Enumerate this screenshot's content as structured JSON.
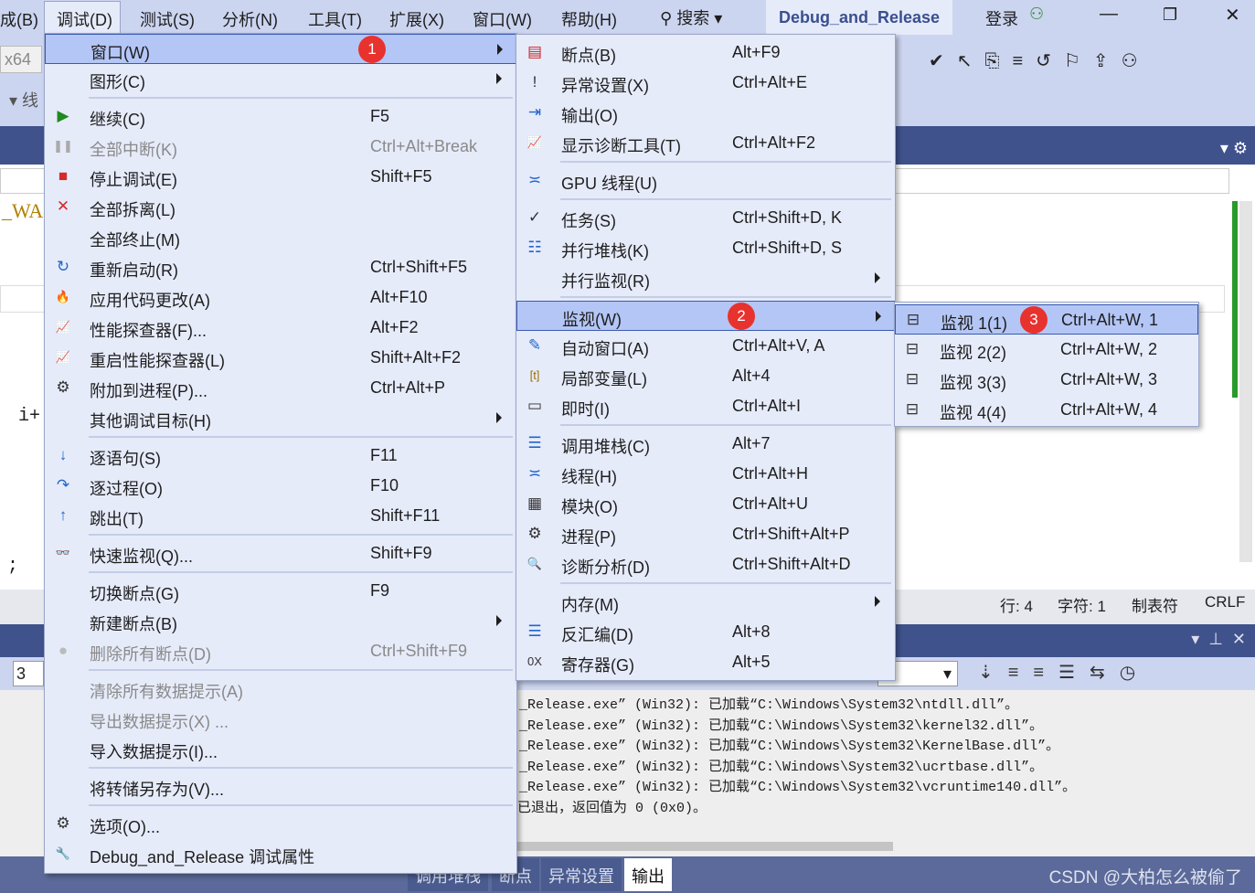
{
  "menubar": {
    "items": [
      "成(B)",
      "调试(D)",
      "测试(S)",
      "分析(N)",
      "工具(T)",
      "扩展(X)",
      "窗口(W)",
      "帮助(H)"
    ],
    "search": "搜索",
    "solution_title": "Debug_and_Release",
    "login": "登录"
  },
  "toolbar": {
    "platform": "x64",
    "thread_label": "线"
  },
  "editor": {
    "snippets": [
      "_WAR",
      "i+",
      ";"
    ]
  },
  "status": {
    "line": "行: 4",
    "char": "字符: 1",
    "tabs": "制表符",
    "eol": "CRLF"
  },
  "output": {
    "stack_field": "3",
    "lines": [
      "_Release.exe” (Win32): 已加载“C:\\Windows\\System32\\ntdll.dll”。",
      "_Release.exe” (Win32): 已加载“C:\\Windows\\System32\\kernel32.dll”。",
      "_Release.exe” (Win32): 已加载“C:\\Windows\\System32\\KernelBase.dll”。",
      "_Release.exe” (Win32): 已加载“C:\\Windows\\System32\\ucrtbase.dll”。",
      "_Release.exe” (Win32): 已加载“C:\\Windows\\System32\\vcruntime140.dll”。",
      "已退出，返回值为 0 (0x0)。"
    ]
  },
  "bottom_tabs": [
    "调用堆栈",
    "断点",
    "异常设置",
    "输出"
  ],
  "watermark": "CSDN @大柏怎么被偷了",
  "debug_menu": [
    {
      "label": "窗口(W)",
      "submenu": true,
      "highlight": true,
      "badge": "1"
    },
    {
      "label": "图形(C)",
      "submenu": true
    },
    {
      "sep": true
    },
    {
      "label": "继续(C)",
      "shortcut": "F5",
      "icon": "play-icon"
    },
    {
      "label": "全部中断(K)",
      "shortcut": "Ctrl+Alt+Break",
      "icon": "pause-icon",
      "disabled": true
    },
    {
      "label": "停止调试(E)",
      "shortcut": "Shift+F5",
      "icon": "stop-icon"
    },
    {
      "label": "全部拆离(L)",
      "icon": "close-icon"
    },
    {
      "label": "全部终止(M)"
    },
    {
      "label": "重新启动(R)",
      "shortcut": "Ctrl+Shift+F5",
      "icon": "restart-icon"
    },
    {
      "label": "应用代码更改(A)",
      "shortcut": "Alt+F10",
      "icon": "flame-icon"
    },
    {
      "label": "性能探查器(F)...",
      "shortcut": "Alt+F2",
      "icon": "chart-icon"
    },
    {
      "label": "重启性能探查器(L)",
      "shortcut": "Shift+Alt+F2",
      "icon": "chart-icon"
    },
    {
      "label": "附加到进程(P)...",
      "shortcut": "Ctrl+Alt+P",
      "icon": "gears-icon"
    },
    {
      "label": "其他调试目标(H)",
      "submenu": true
    },
    {
      "sep": true
    },
    {
      "label": "逐语句(S)",
      "shortcut": "F11",
      "icon": "step-into-icon"
    },
    {
      "label": "逐过程(O)",
      "shortcut": "F10",
      "icon": "step-over-icon"
    },
    {
      "label": "跳出(T)",
      "shortcut": "Shift+F11",
      "icon": "step-out-icon"
    },
    {
      "sep": true
    },
    {
      "label": "快速监视(Q)...",
      "shortcut": "Shift+F9",
      "icon": "glasses-icon"
    },
    {
      "sep": true
    },
    {
      "label": "切换断点(G)",
      "shortcut": "F9"
    },
    {
      "label": "新建断点(B)",
      "submenu": true
    },
    {
      "label": "删除所有断点(D)",
      "shortcut": "Ctrl+Shift+F9",
      "icon": "delete-breakpoints-icon",
      "disabled": true
    },
    {
      "sep": true
    },
    {
      "label": "清除所有数据提示(A)",
      "disabled": true
    },
    {
      "label": "导出数据提示(X) ...",
      "disabled": true
    },
    {
      "label": "导入数据提示(I)..."
    },
    {
      "sep": true
    },
    {
      "label": "将转储另存为(V)..."
    },
    {
      "sep": true
    },
    {
      "label": "选项(O)...",
      "icon": "gear-icon"
    },
    {
      "label": "Debug_and_Release 调试属性",
      "icon": "wrench-icon"
    }
  ],
  "window_menu": [
    {
      "label": "断点(B)",
      "shortcut": "Alt+F9",
      "icon": "breakpoints-window-icon"
    },
    {
      "label": "异常设置(X)",
      "shortcut": "Ctrl+Alt+E",
      "icon": "exception-icon"
    },
    {
      "label": "输出(O)",
      "shortcut": "",
      "icon": "output-icon"
    },
    {
      "label": "显示诊断工具(T)",
      "shortcut": "Ctrl+Alt+F2",
      "icon": "chart-icon"
    },
    {
      "sep": true
    },
    {
      "label": "GPU 线程(U)",
      "icon": "threads-icon"
    },
    {
      "sep": true
    },
    {
      "label": "任务(S)",
      "shortcut": "Ctrl+Shift+D, K",
      "icon": "tasks-icon"
    },
    {
      "label": "并行堆栈(K)",
      "shortcut": "Ctrl+Shift+D, S",
      "icon": "parallel-stacks-icon"
    },
    {
      "label": "并行监视(R)",
      "submenu": true
    },
    {
      "sep": true
    },
    {
      "label": "监视(W)",
      "submenu": true,
      "highlight": true,
      "badge": "2"
    },
    {
      "label": "自动窗口(A)",
      "shortcut": "Ctrl+Alt+V, A",
      "icon": "autos-icon"
    },
    {
      "label": "局部变量(L)",
      "shortcut": "Alt+4",
      "icon": "locals-icon"
    },
    {
      "label": "即时(I)",
      "shortcut": "Ctrl+Alt+I",
      "icon": "immediate-icon"
    },
    {
      "sep": true
    },
    {
      "label": "调用堆栈(C)",
      "shortcut": "Alt+7",
      "icon": "call-stack-icon"
    },
    {
      "label": "线程(H)",
      "shortcut": "Ctrl+Alt+H",
      "icon": "threads-icon"
    },
    {
      "label": "模块(O)",
      "shortcut": "Ctrl+Alt+U",
      "icon": "modules-icon"
    },
    {
      "label": "进程(P)",
      "shortcut": "Ctrl+Shift+Alt+P",
      "icon": "gears-icon"
    },
    {
      "label": "诊断分析(D)",
      "shortcut": "Ctrl+Shift+Alt+D",
      "icon": "diagnostics-icon"
    },
    {
      "sep": true
    },
    {
      "label": "内存(M)",
      "submenu": true
    },
    {
      "label": "反汇编(D)",
      "shortcut": "Alt+8",
      "icon": "disassembly-icon"
    },
    {
      "label": "寄存器(G)",
      "shortcut": "Alt+5",
      "icon": "registers-icon"
    }
  ],
  "watch_menu": [
    {
      "label": "监视 1(1)",
      "shortcut": "Ctrl+Alt+W, 1",
      "icon": "watch-icon",
      "highlight": true,
      "badge": "3"
    },
    {
      "label": "监视 2(2)",
      "shortcut": "Ctrl+Alt+W, 2",
      "icon": "watch-icon"
    },
    {
      "label": "监视 3(3)",
      "shortcut": "Ctrl+Alt+W, 3",
      "icon": "watch-icon"
    },
    {
      "label": "监视 4(4)",
      "shortcut": "Ctrl+Alt+W, 4",
      "icon": "watch-icon"
    }
  ]
}
